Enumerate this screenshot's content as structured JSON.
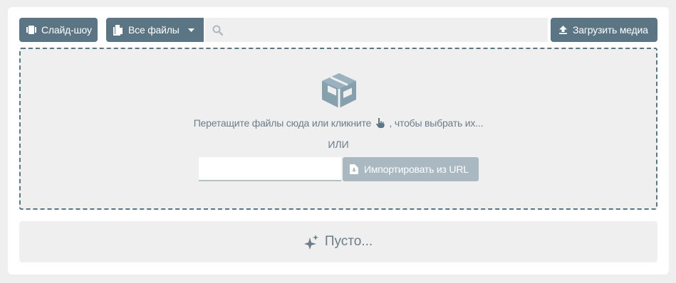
{
  "toolbar": {
    "slideshow_label": "Слайд-шоу",
    "files_label": "Все файлы",
    "search_placeholder": "",
    "upload_label": "Загрузить медиа"
  },
  "dropzone": {
    "drag_text_before": "Перетащите файлы сюда или кликните",
    "drag_text_after": ", чтобы выбрать их...",
    "or_label": "ИЛИ",
    "url_placeholder": "",
    "import_label": "Импортировать из URL"
  },
  "empty": {
    "label": "Пусто..."
  },
  "icons": {
    "slideshow": "slideshow-icon",
    "files": "file-copy-icon",
    "dropdown": "caret-down-icon",
    "search": "search-icon",
    "upload": "upload-icon",
    "box": "open-box-icon",
    "hand": "pointing-hand-icon",
    "link": "link-icon",
    "import": "file-download-icon",
    "sparkle": "sparkle-icon"
  },
  "colors": {
    "primary": "#5b7584",
    "primary_disabled": "#a9b8c1",
    "panel_bg": "#efefef",
    "muted_text": "#6b7d88"
  }
}
